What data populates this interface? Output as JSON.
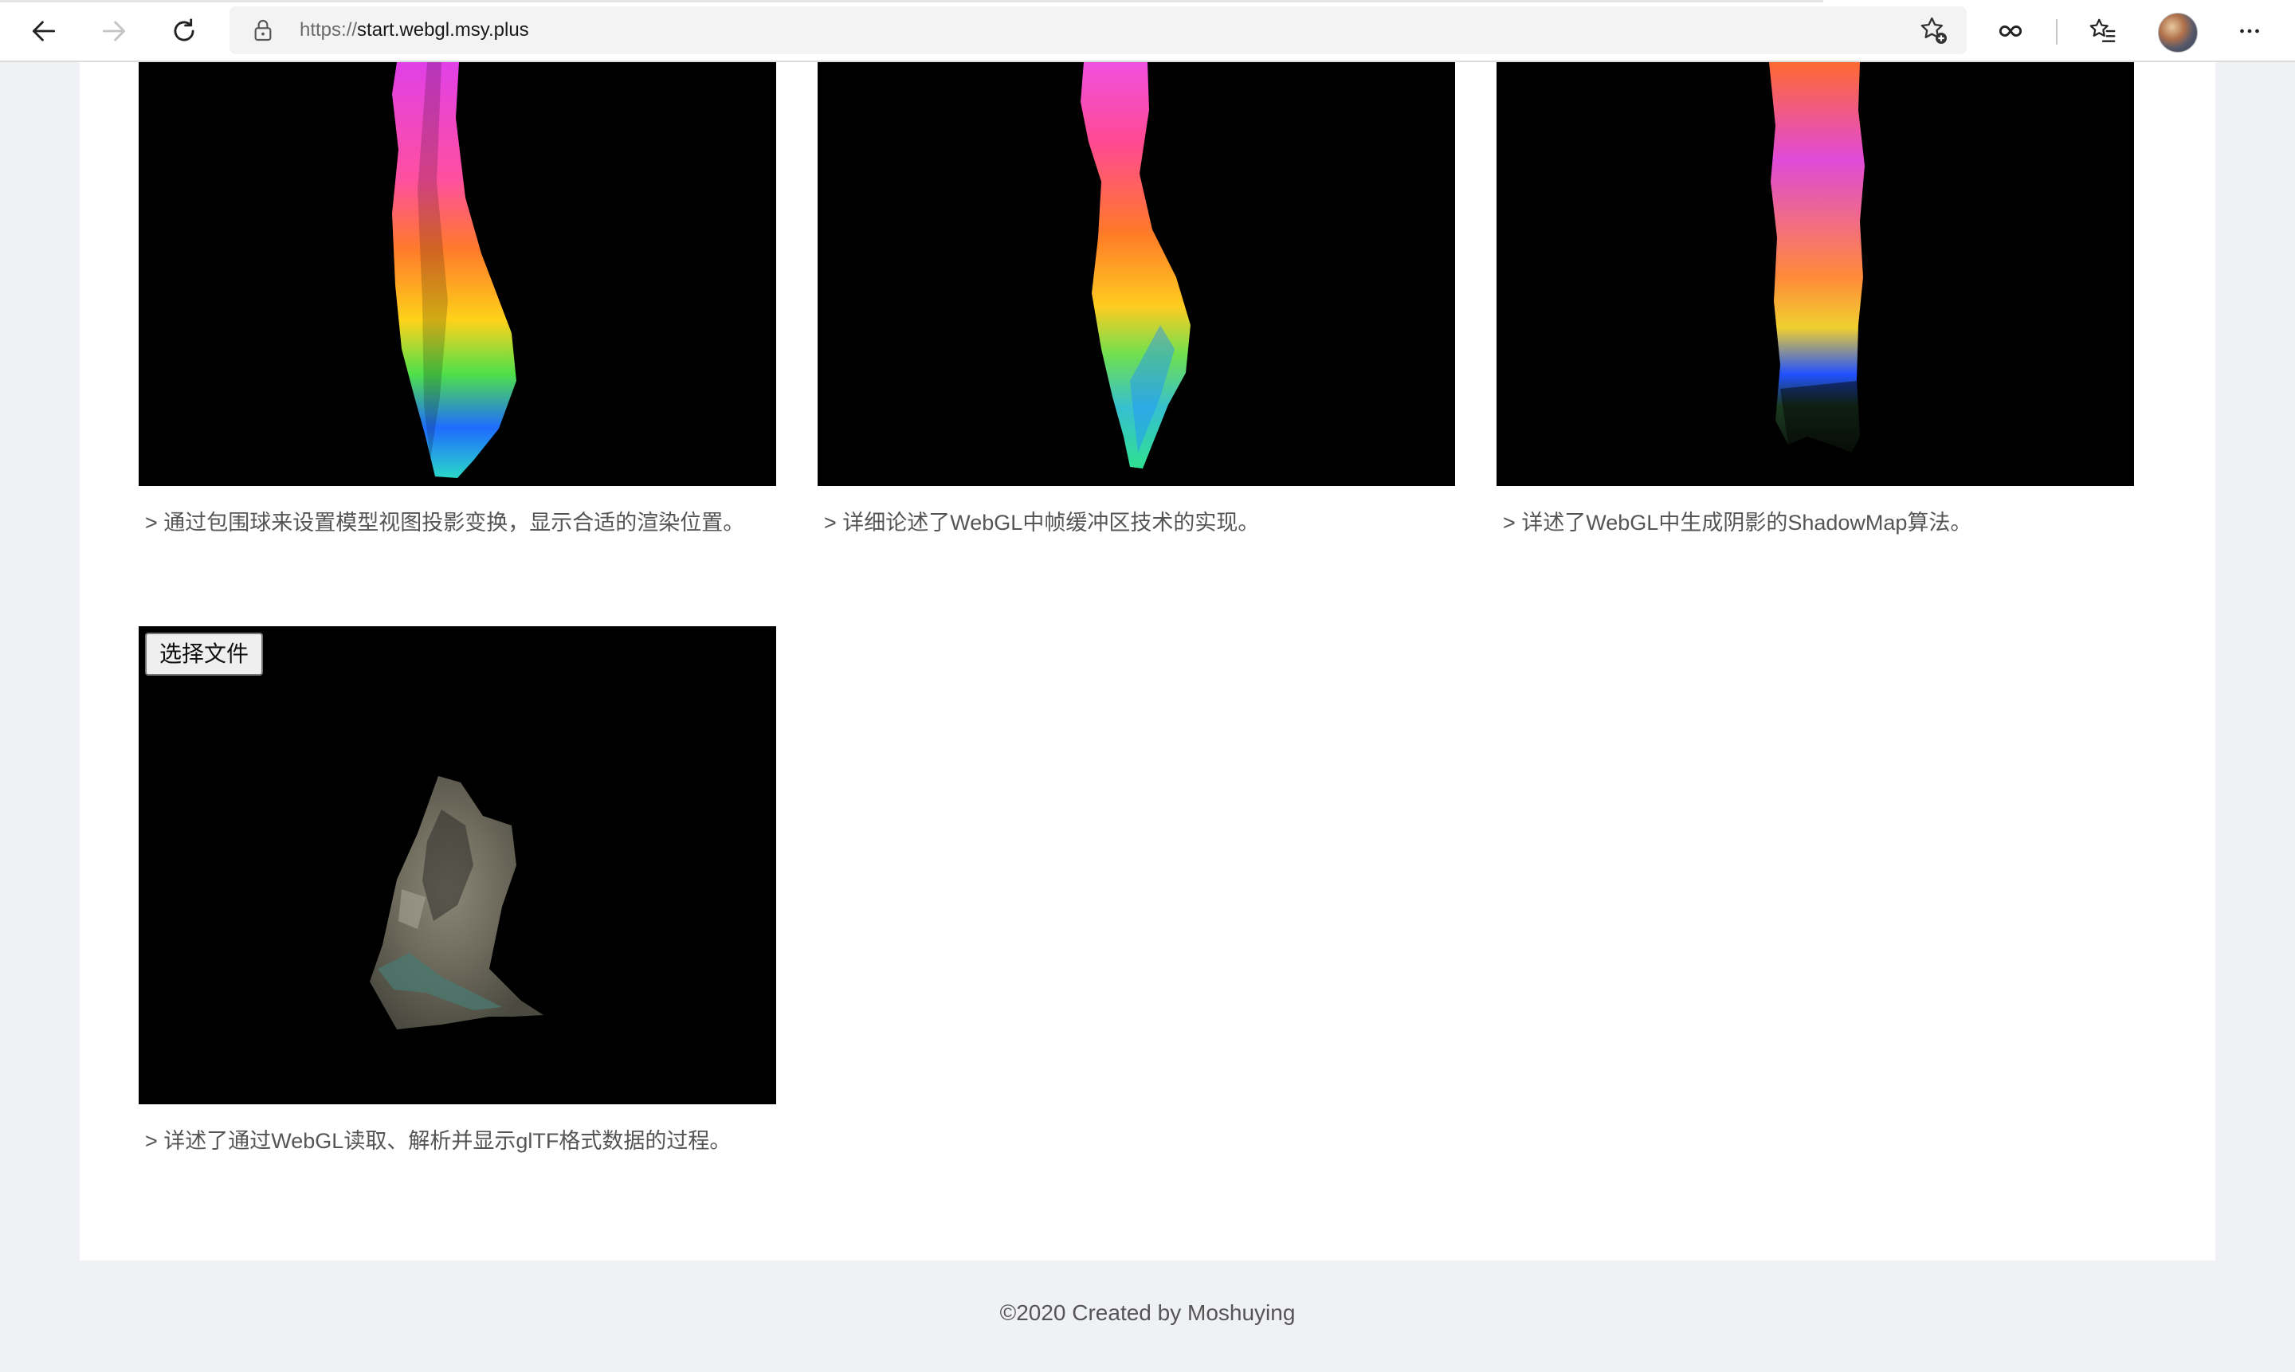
{
  "browser": {
    "url_protocol": "https://",
    "url_host": "start.webgl.msy.plus",
    "icons": {
      "back": "arrow-left-icon",
      "forward": "arrow-right-icon",
      "refresh": "refresh-icon",
      "lock": "lock-icon",
      "add_favorite": "star-plus-icon",
      "reading": "infinity-link-icon",
      "favorites": "favorites-list-icon",
      "menu": "more-horizontal-icon"
    }
  },
  "gallery": {
    "tiles": [
      {
        "description": "> 通过包围球来设置模型视图投影变换，显示合适的渲染位置。",
        "image": "rainbow terrain render"
      },
      {
        "description": "> 详细论述了WebGL中帧缓冲区技术的实现。",
        "image": "rainbow terrain render"
      },
      {
        "description": "> 详述了WebGL中生成阴影的ShadowMap算法。",
        "image": "rainbow terrain render with shadow"
      },
      {
        "description": "> 详述了通过WebGL读取、解析并显示glTF格式数据的过程。",
        "image": "textured satellite terrain model",
        "file_button_label": "选择文件"
      }
    ]
  },
  "footer": {
    "copyright": "©2020 Created by Moshuying"
  },
  "colors": {
    "page_background": "#f0f1f4",
    "card_background": "#ffffff",
    "canvas_background": "#000000",
    "text": "#555555"
  }
}
